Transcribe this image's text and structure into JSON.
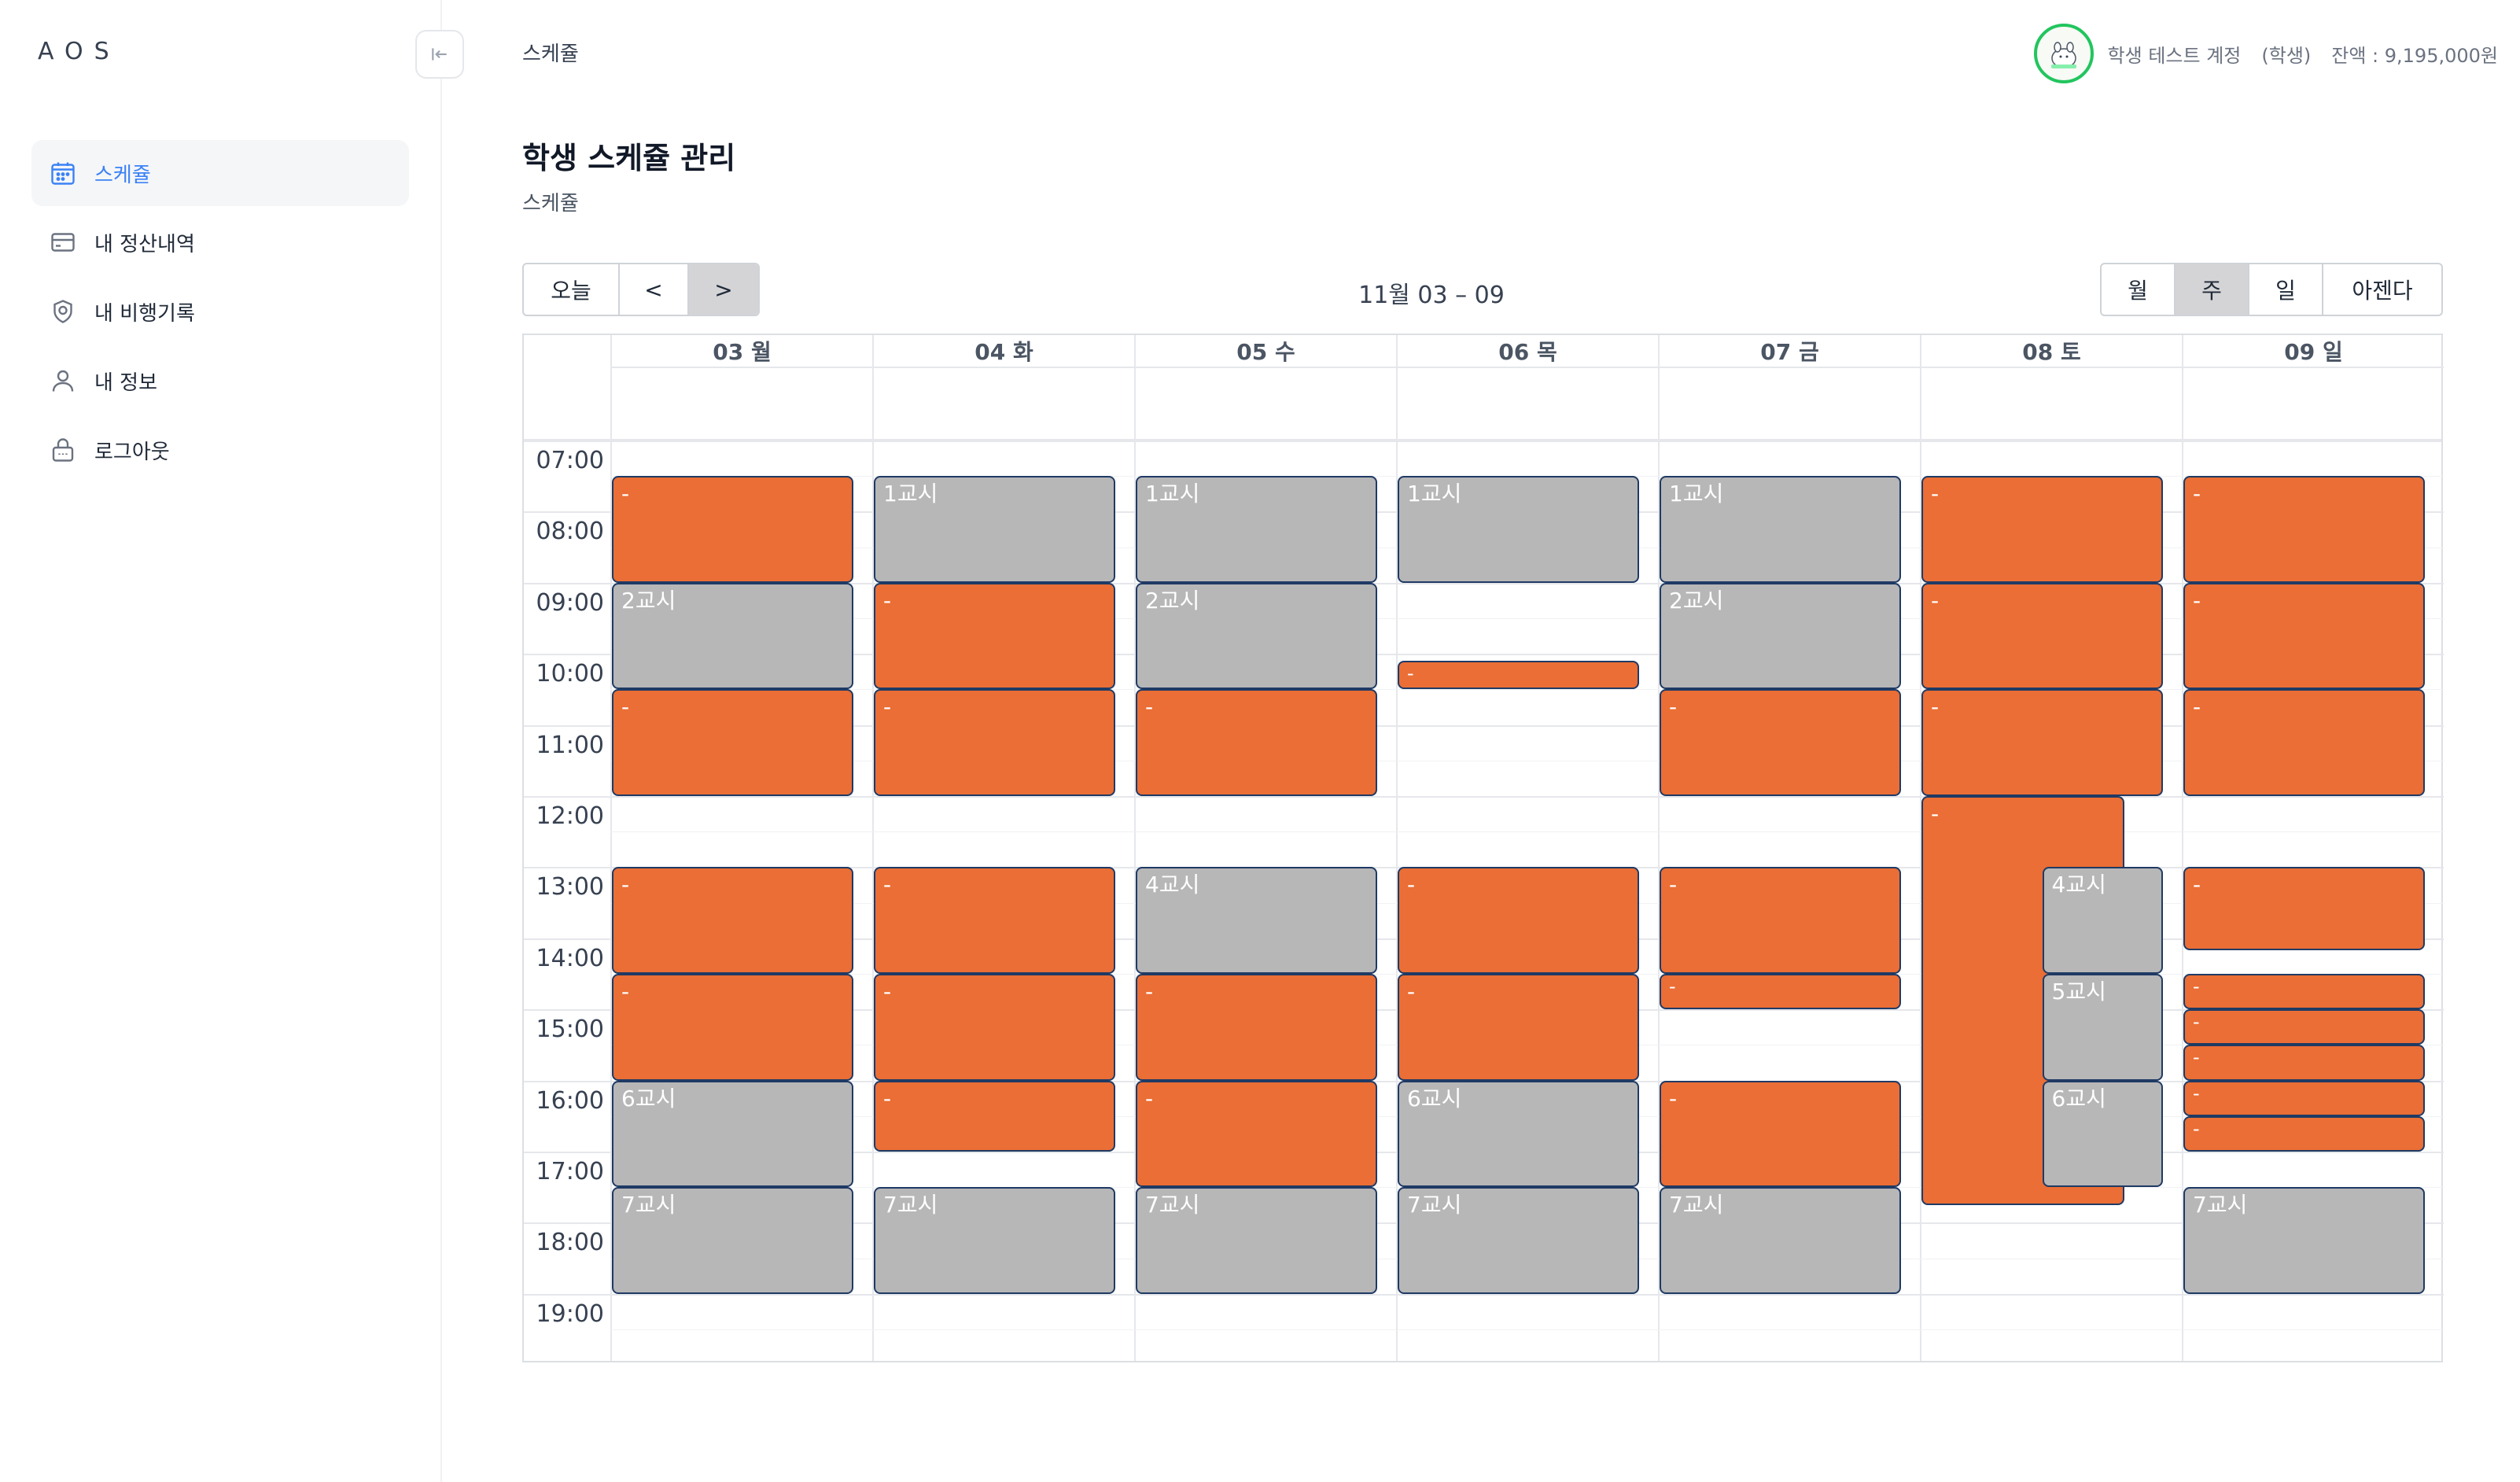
{
  "app": {
    "logo": "AOS",
    "page_label": "스케쥴"
  },
  "sidebar": {
    "items": [
      {
        "label": "스케쥴",
        "icon": "calendar-icon",
        "active": true
      },
      {
        "label": "내 정산내역",
        "icon": "card-icon",
        "active": false
      },
      {
        "label": "내 비행기록",
        "icon": "badge-icon",
        "active": false
      },
      {
        "label": "내 정보",
        "icon": "user-icon",
        "active": false
      },
      {
        "label": "로그아웃",
        "icon": "lock-icon",
        "active": false
      }
    ]
  },
  "header": {
    "user_name": "학생 테스트 계정",
    "role": "(학생)",
    "balance": "잔액 : 9,195,000원"
  },
  "page": {
    "title": "학생 스케쥴 관리",
    "subtitle": "스케쥴"
  },
  "toolbar": {
    "today": "오늘",
    "prev": "<",
    "next": ">",
    "range": "11월 03 – 09",
    "views": [
      "월",
      "주",
      "일",
      "아젠다"
    ],
    "selected_view": "주"
  },
  "calendar": {
    "days": [
      "03 월",
      "04 화",
      "05 수",
      "06 목",
      "07 금",
      "08 토",
      "09 일"
    ],
    "hours": [
      "07:00",
      "08:00",
      "09:00",
      "10:00",
      "11:00",
      "12:00",
      "13:00",
      "14:00",
      "15:00",
      "16:00",
      "17:00",
      "18:00",
      "19:00"
    ],
    "events": [
      {
        "day": 0,
        "start": 7.5,
        "end": 9,
        "label": "-",
        "type": "orange"
      },
      {
        "day": 0,
        "start": 9,
        "end": 10.5,
        "label": "2교시",
        "type": "gray"
      },
      {
        "day": 0,
        "start": 10.5,
        "end": 12,
        "label": "-",
        "type": "orange"
      },
      {
        "day": 0,
        "start": 13,
        "end": 14.5,
        "label": "-",
        "type": "orange"
      },
      {
        "day": 0,
        "start": 14.5,
        "end": 16,
        "label": "-",
        "type": "orange"
      },
      {
        "day": 0,
        "start": 16,
        "end": 17.5,
        "label": "6교시",
        "type": "gray"
      },
      {
        "day": 0,
        "start": 17.5,
        "end": 19,
        "label": "7교시",
        "type": "gray"
      },
      {
        "day": 1,
        "start": 7.5,
        "end": 9,
        "label": "1교시",
        "type": "gray"
      },
      {
        "day": 1,
        "start": 9,
        "end": 10.5,
        "label": "-",
        "type": "orange"
      },
      {
        "day": 1,
        "start": 10.5,
        "end": 12,
        "label": "-",
        "type": "orange"
      },
      {
        "day": 1,
        "start": 13,
        "end": 14.5,
        "label": "-",
        "type": "orange"
      },
      {
        "day": 1,
        "start": 14.5,
        "end": 16,
        "label": "-",
        "type": "orange"
      },
      {
        "day": 1,
        "start": 16,
        "end": 17,
        "label": "-",
        "type": "orange"
      },
      {
        "day": 1,
        "start": 17.5,
        "end": 19,
        "label": "7교시",
        "type": "gray"
      },
      {
        "day": 2,
        "start": 7.5,
        "end": 9,
        "label": "1교시",
        "type": "gray"
      },
      {
        "day": 2,
        "start": 9,
        "end": 10.5,
        "label": "2교시",
        "type": "gray"
      },
      {
        "day": 2,
        "start": 10.5,
        "end": 12,
        "label": "-",
        "type": "orange"
      },
      {
        "day": 2,
        "start": 13,
        "end": 14.5,
        "label": "4교시",
        "type": "gray"
      },
      {
        "day": 2,
        "start": 14.5,
        "end": 16,
        "label": "-",
        "type": "orange"
      },
      {
        "day": 2,
        "start": 16,
        "end": 17.5,
        "label": "-",
        "type": "orange"
      },
      {
        "day": 2,
        "start": 17.5,
        "end": 19,
        "label": "7교시",
        "type": "gray"
      },
      {
        "day": 3,
        "start": 7.5,
        "end": 9,
        "label": "1교시",
        "type": "gray"
      },
      {
        "day": 3,
        "start": 10.1,
        "end": 10.5,
        "label": "-",
        "type": "orange"
      },
      {
        "day": 3,
        "start": 13,
        "end": 14.5,
        "label": "-",
        "type": "orange"
      },
      {
        "day": 3,
        "start": 14.5,
        "end": 16,
        "label": "-",
        "type": "orange"
      },
      {
        "day": 3,
        "start": 16,
        "end": 17.5,
        "label": "6교시",
        "type": "gray"
      },
      {
        "day": 3,
        "start": 17.5,
        "end": 19,
        "label": "7교시",
        "type": "gray"
      },
      {
        "day": 4,
        "start": 7.5,
        "end": 9,
        "label": "1교시",
        "type": "gray"
      },
      {
        "day": 4,
        "start": 9,
        "end": 10.5,
        "label": "2교시",
        "type": "gray"
      },
      {
        "day": 4,
        "start": 10.5,
        "end": 12,
        "label": "-",
        "type": "orange"
      },
      {
        "day": 4,
        "start": 13,
        "end": 14.5,
        "label": "-",
        "type": "orange"
      },
      {
        "day": 4,
        "start": 14.5,
        "end": 15,
        "label": "-",
        "type": "orange"
      },
      {
        "day": 4,
        "start": 16,
        "end": 17.5,
        "label": "-",
        "type": "orange"
      },
      {
        "day": 4,
        "start": 17.5,
        "end": 19,
        "label": "7교시",
        "type": "gray"
      },
      {
        "day": 5,
        "start": 7.5,
        "end": 9,
        "label": "-",
        "type": "orange"
      },
      {
        "day": 5,
        "start": 9,
        "end": 10.5,
        "label": "-",
        "type": "orange"
      },
      {
        "day": 5,
        "start": 10.5,
        "end": 12,
        "label": "-",
        "type": "orange"
      },
      {
        "day": 5,
        "start": 12,
        "end": 17.75,
        "label": "-",
        "type": "orange",
        "left": 0,
        "right": 0.84
      },
      {
        "day": 5,
        "start": 13,
        "end": 14.5,
        "label": "4교시",
        "type": "gray",
        "left": 0.5,
        "right": 1
      },
      {
        "day": 5,
        "start": 14.5,
        "end": 16,
        "label": "5교시",
        "type": "gray",
        "left": 0.5,
        "right": 1
      },
      {
        "day": 5,
        "start": 16,
        "end": 17.5,
        "label": "6교시",
        "type": "gray",
        "left": 0.5,
        "right": 1
      },
      {
        "day": 6,
        "start": 7.5,
        "end": 9,
        "label": "-",
        "type": "orange"
      },
      {
        "day": 6,
        "start": 9,
        "end": 10.5,
        "label": "-",
        "type": "orange"
      },
      {
        "day": 6,
        "start": 10.5,
        "end": 12,
        "label": "-",
        "type": "orange"
      },
      {
        "day": 6,
        "start": 13,
        "end": 14.17,
        "label": "-",
        "type": "orange"
      },
      {
        "day": 6,
        "start": 14.5,
        "end": 15,
        "label": "-",
        "type": "orange"
      },
      {
        "day": 6,
        "start": 15,
        "end": 15.5,
        "label": "-",
        "type": "orange"
      },
      {
        "day": 6,
        "start": 15.5,
        "end": 16,
        "label": "-",
        "type": "orange"
      },
      {
        "day": 6,
        "start": 16,
        "end": 16.5,
        "label": "-",
        "type": "orange"
      },
      {
        "day": 6,
        "start": 16.5,
        "end": 17,
        "label": "-",
        "type": "orange"
      },
      {
        "day": 6,
        "start": 17.5,
        "end": 19,
        "label": "7교시",
        "type": "gray"
      }
    ]
  },
  "colors": {
    "event_orange": "#ea6e35",
    "event_gray": "#b7b7b8",
    "accent": "#3b82f6"
  }
}
